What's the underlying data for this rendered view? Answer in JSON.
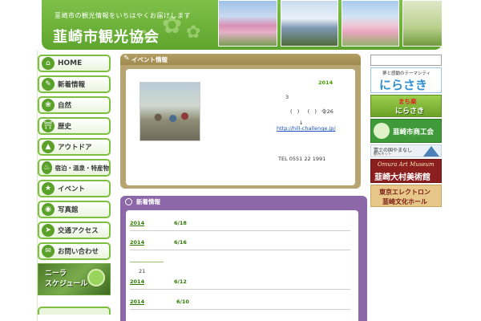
{
  "header": {
    "tagline": "韮崎市の観光情報をいちはやくお届けします",
    "site_title": "韮崎市観光協会"
  },
  "nav": {
    "items": [
      {
        "label": "HOME",
        "icon": "home-icon"
      },
      {
        "label": "新着情報",
        "icon": "news-icon"
      },
      {
        "label": "自然",
        "icon": "nature-icon"
      },
      {
        "label": "歴史",
        "icon": "history-icon"
      },
      {
        "label": "アウトドア",
        "icon": "outdoor-icon"
      },
      {
        "label": "宿泊・温泉・特産物",
        "icon": "lodging-icon"
      },
      {
        "label": "イベント",
        "icon": "event-icon"
      },
      {
        "label": "写真館",
        "icon": "photo-icon"
      },
      {
        "label": "交通アクセス",
        "icon": "access-icon"
      },
      {
        "label": "お問い合わせ",
        "icon": "contact-icon"
      }
    ],
    "schedule_line1": "ニーラ",
    "schedule_line2": "スケジュール"
  },
  "events": {
    "title": "イベント情報",
    "year": "2014",
    "line1": "3",
    "line2": "(   )     (   )   令26",
    "arrow": "↓",
    "link": "http://hill-challenge.jp/",
    "tel": "TEL 0551 22 1991"
  },
  "news": {
    "title": "新着情報",
    "items": [
      {
        "year": "2014",
        "md": "6/18"
      },
      {
        "year": "2014",
        "md": "6/16"
      },
      {
        "year": "2014",
        "md": "6/12"
      },
      {
        "year": "2014",
        "md": "6/10"
      }
    ],
    "count": "21"
  },
  "sidebar": {
    "search_placeholder": "",
    "nirasaki_sub": "夢と感動のテーマシティ",
    "nirasaki_main": "にらさき",
    "machiraku_line1": "まち楽",
    "machiraku_line2": "にらさき",
    "chamber": "韮崎市商工会",
    "fuji_line1": "富士の国やまなし",
    "fuji_line2": "観光ネット",
    "museum_line1": "Omura Art Museum",
    "museum_line2": "韮崎大村美術館",
    "hall_line1": "東京エレクトロン",
    "hall_line2": "韮崎文化ホール"
  },
  "colors": {
    "brand_green": "#5ea52d",
    "events_gold": "#b8a470",
    "news_purple": "#8c68a8",
    "link_blue": "#1a4fbf"
  }
}
